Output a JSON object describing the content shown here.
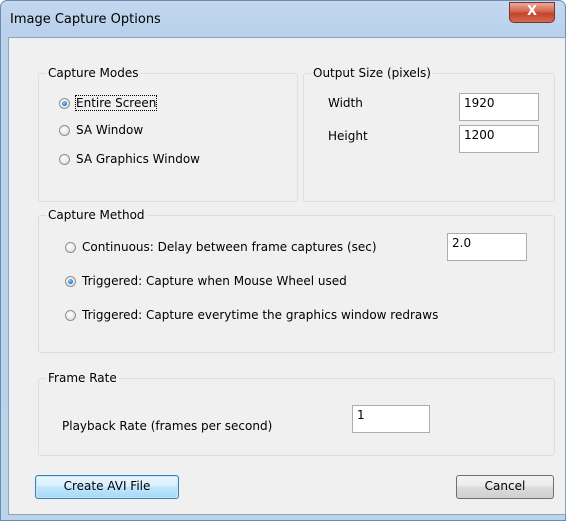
{
  "window": {
    "title": "Image Capture Options",
    "close_label": "X"
  },
  "capture_modes": {
    "legend": "Capture Modes",
    "options": [
      {
        "label": "Entire Screen",
        "checked": true
      },
      {
        "label": "SA Window",
        "checked": false
      },
      {
        "label": "SA Graphics Window",
        "checked": false
      }
    ]
  },
  "output_size": {
    "legend": "Output Size (pixels)",
    "width_label": "Width",
    "width_value": "1920",
    "height_label": "Height",
    "height_value": "1200"
  },
  "capture_method": {
    "legend": "Capture Method",
    "options": [
      {
        "label": "Continuous: Delay between frame captures (sec)",
        "checked": false
      },
      {
        "label": "Triggered: Capture when Mouse Wheel used",
        "checked": true
      },
      {
        "label": "Triggered: Capture everytime the graphics window redraws",
        "checked": false
      }
    ],
    "delay_value": "2.0"
  },
  "frame_rate": {
    "legend": "Frame Rate",
    "playback_label": "Playback Rate (frames per second)",
    "playback_value": "1"
  },
  "buttons": {
    "create_avi": "Create AVI File",
    "cancel": "Cancel"
  }
}
